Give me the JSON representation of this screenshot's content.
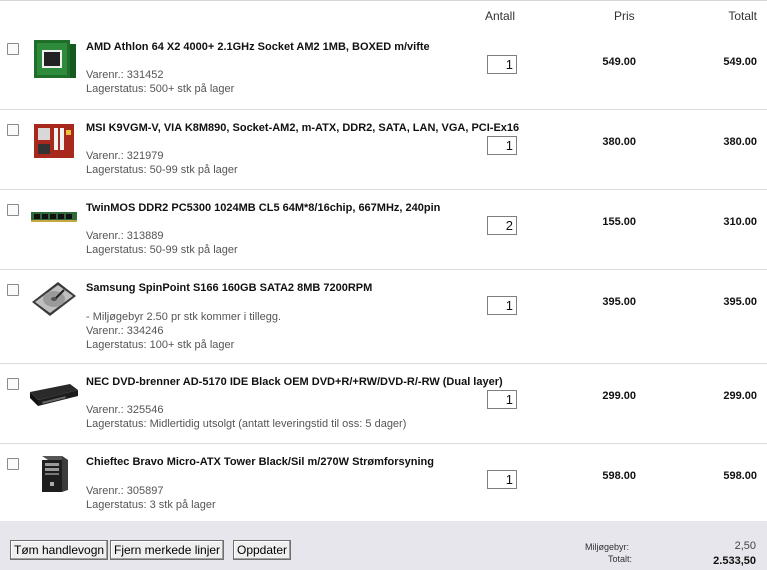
{
  "header": {
    "antall": "Antall",
    "pris": "Pris",
    "totalt": "Totalt"
  },
  "items": [
    {
      "name": "AMD Athlon 64 X2 4000+ 2.1GHz Socket AM2 1MB, BOXED m/vifte",
      "note": "",
      "varenr": "Varenr.: 331452",
      "lager": "Lagerstatus: 500+ stk på lager",
      "qty": "1",
      "price": "549.00",
      "total": "549.00",
      "icon": "cpu-box-icon"
    },
    {
      "name": "MSI K9VGM-V, VIA K8M890, Socket-AM2, m-ATX, DDR2, SATA, LAN, VGA, PCI-Ex16",
      "note": "",
      "varenr": "Varenr.: 321979",
      "lager": "Lagerstatus: 50-99 stk på lager",
      "qty": "1",
      "price": "380.00",
      "total": "380.00",
      "icon": "motherboard-icon"
    },
    {
      "name": "TwinMOS DDR2 PC5300 1024MB CL5 64M*8/16chip, 667MHz, 240pin",
      "note": "",
      "varenr": "Varenr.: 313889",
      "lager": "Lagerstatus: 50-99 stk på lager",
      "qty": "2",
      "price": "155.00",
      "total": "310.00",
      "icon": "ram-icon"
    },
    {
      "name": "Samsung SpinPoint S166 160GB SATA2 8MB 7200RPM",
      "note": "- Miljøgebyr 2.50 pr stk kommer i tillegg.",
      "varenr": "Varenr.: 334246",
      "lager": "Lagerstatus: 100+ stk på lager",
      "qty": "1",
      "price": "395.00",
      "total": "395.00",
      "icon": "hard-drive-icon"
    },
    {
      "name": "NEC DVD-brenner AD-5170 IDE Black OEM DVD+R/+RW/DVD-R/-RW (Dual layer)",
      "note": "",
      "varenr": "Varenr.: 325546",
      "lager": "Lagerstatus: Midlertidig utsolgt (antatt leveringstid til oss: 5 dager)",
      "qty": "1",
      "price": "299.00",
      "total": "299.00",
      "icon": "dvd-drive-icon"
    },
    {
      "name": "Chieftec Bravo Micro-ATX Tower Black/Sil m/270W Strømforsyning",
      "note": "",
      "varenr": "Varenr.: 305897",
      "lager": "Lagerstatus: 3 stk på lager",
      "qty": "1",
      "price": "598.00",
      "total": "598.00",
      "icon": "pc-tower-icon"
    }
  ],
  "footer": {
    "buttons": {
      "clear": "Tøm handlevogn",
      "remove": "Fjern merkede linjer",
      "update": "Oppdater"
    },
    "miljo_label": "Miljøgebyr:",
    "miljo_value": "2,50",
    "total_label": "Totalt:",
    "total_value": "2.533,50"
  }
}
